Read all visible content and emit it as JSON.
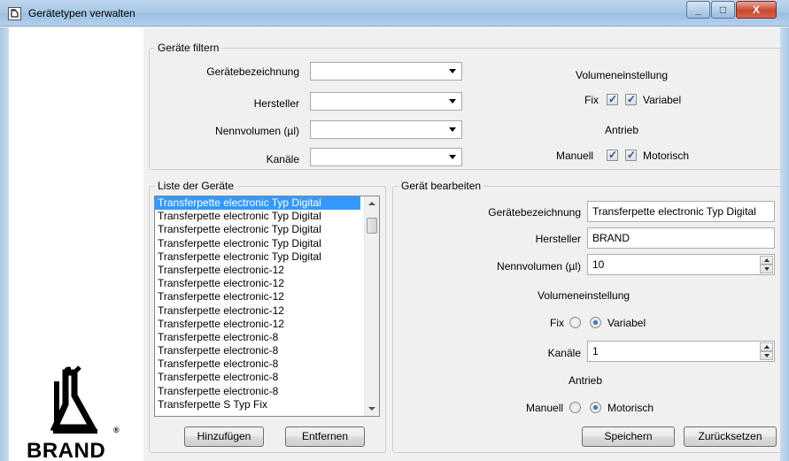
{
  "window": {
    "title": "Gerätetypen verwalten",
    "min_glyph": "_",
    "max_glyph": "□",
    "close_glyph": "X"
  },
  "brand": {
    "name": "BRAND",
    "reg": "®"
  },
  "filter": {
    "title": "Geräte filtern",
    "labels": {
      "device_name": "Gerätebezeichnung",
      "manufacturer": "Hersteller",
      "nominal_volume": "Nennvolumen (µl)",
      "channels": "Kanäle"
    },
    "volume_heading": "Volumeneinstellung",
    "fix_label": "Fix",
    "variable_label": "Variabel",
    "drive_heading": "Antrieb",
    "manual_label": "Manuell",
    "motor_label": "Motorisch",
    "checks": {
      "fix": true,
      "variable": true,
      "manual": true,
      "motor": true
    }
  },
  "list": {
    "title": "Liste der Geräte",
    "items": [
      "Transferpette electronic Typ Digital",
      "Transferpette electronic Typ Digital",
      "Transferpette electronic Typ Digital",
      "Transferpette electronic Typ Digital",
      "Transferpette electronic Typ Digital",
      "Transferpette electronic-12",
      "Transferpette electronic-12",
      "Transferpette electronic-12",
      "Transferpette electronic-12",
      "Transferpette electronic-12",
      "Transferpette electronic-8",
      "Transferpette electronic-8",
      "Transferpette electronic-8",
      "Transferpette electronic-8",
      "Transferpette electronic-8",
      "Transferpette S Typ Fix"
    ],
    "add_label": "Hinzufügen",
    "remove_label": "Entfernen"
  },
  "edit": {
    "title": "Gerät bearbeiten",
    "device_name_label": "Gerätebezeichnung",
    "device_name_value": "Transferpette electronic Typ Digital",
    "manufacturer_label": "Hersteller",
    "manufacturer_value": "BRAND",
    "volume_label": "Nennvolumen (µl)",
    "volume_value": "10",
    "volume_heading": "Volumeneinstellung",
    "fix_label": "Fix",
    "variable_label": "Variabel",
    "channels_label": "Kanäle",
    "channels_value": "1",
    "drive_heading": "Antrieb",
    "manual_label": "Manuell",
    "motor_label": "Motorisch",
    "selected_volume_mode": "Variabel",
    "selected_drive": "Motorisch",
    "save_label": "Speichern",
    "reset_label": "Zurücksetzen"
  }
}
